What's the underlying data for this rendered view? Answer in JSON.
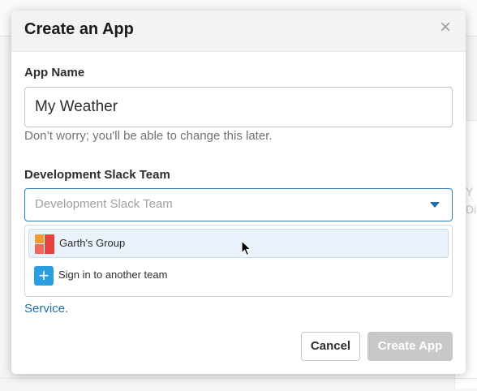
{
  "background": {
    "side_text_1": "Y",
    "side_text_2": "Di",
    "side_link": "r"
  },
  "modal": {
    "title": "Create an App",
    "close_icon": "close-icon"
  },
  "app_name": {
    "label": "App Name",
    "value": "My Weather",
    "hint": "Don’t worry; you'll be able to change this later."
  },
  "team": {
    "label": "Development Slack Team",
    "placeholder": "Development Slack Team",
    "options": [
      {
        "label": "Garth's Group",
        "icon": "team-icon",
        "highlighted": true
      },
      {
        "label": "Sign in to another team",
        "icon": "plus-icon",
        "highlighted": false
      }
    ]
  },
  "service_link": {
    "text": "Service",
    "suffix": "."
  },
  "buttons": {
    "cancel": "Cancel",
    "create": "Create App"
  },
  "colors": {
    "accent": "#1d6ea8",
    "disabled": "#c8c8c8",
    "highlight": "#eaf2fb"
  }
}
